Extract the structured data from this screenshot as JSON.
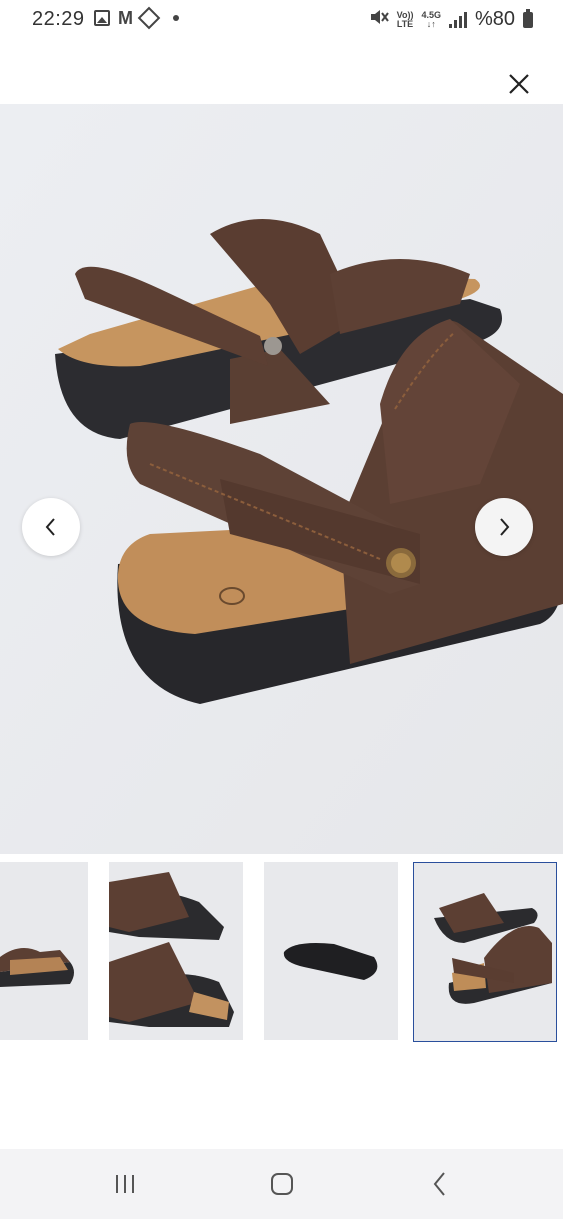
{
  "status_bar": {
    "time": "22:29",
    "volte_top": "Vo))",
    "volte_bottom": "LTE",
    "net_top": "4.5G",
    "net_bottom": "↓↑",
    "battery": "%80"
  },
  "icons": {
    "close": "close-icon",
    "prev": "chevron-left-icon",
    "next": "chevron-right-icon",
    "recent": "recent-apps-icon",
    "home": "home-icon",
    "back": "back-icon"
  },
  "colors": {
    "selected_thumb_border": "#2a4f9c",
    "image_bg": "#ecedf0",
    "sandal_brown": "#5a3e33",
    "footbed": "#c89a68",
    "sole": "#2a2a2e"
  },
  "gallery": {
    "thumbnail_count": 4,
    "selected_index": 4
  }
}
